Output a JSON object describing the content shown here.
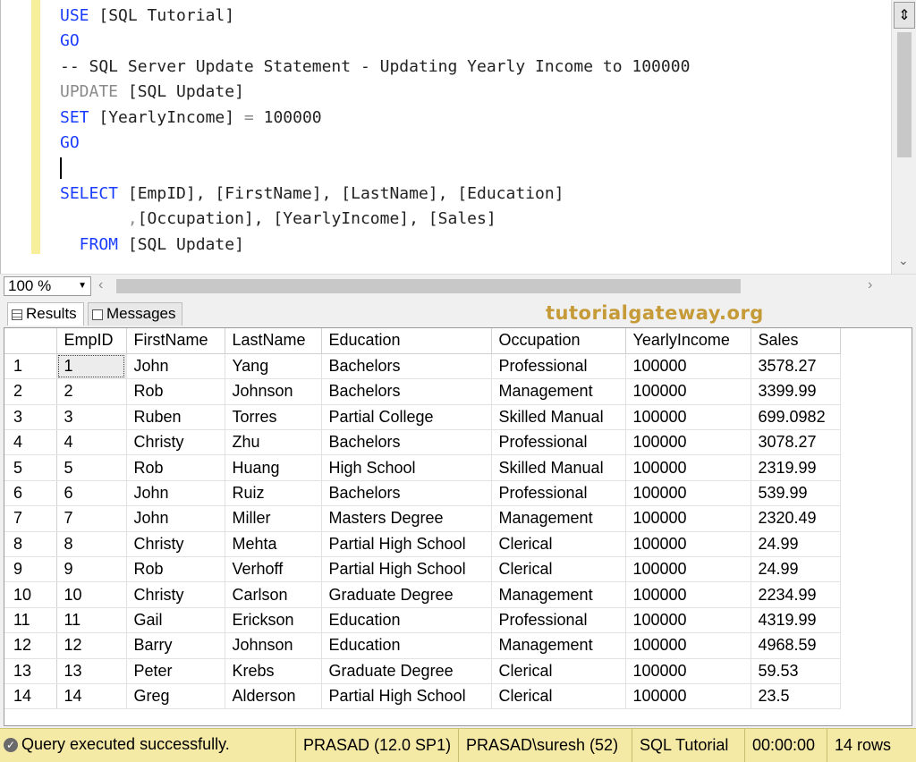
{
  "editor": {
    "lines": [
      {
        "parts": [
          {
            "t": "USE ",
            "c": "kw"
          },
          {
            "t": "[SQL Tutorial]",
            "c": "str"
          }
        ]
      },
      {
        "parts": [
          {
            "t": "GO",
            "c": "kw"
          }
        ]
      },
      {
        "parts": [
          {
            "t": "-- SQL Server Update Statement - Updating Yearly Income to 100000",
            "c": "str"
          }
        ]
      },
      {
        "parts": [
          {
            "t": "UPDATE ",
            "c": "gray"
          },
          {
            "t": "[SQL Update]",
            "c": "str"
          }
        ]
      },
      {
        "parts": [
          {
            "t": "SET ",
            "c": "kw"
          },
          {
            "t": "[YearlyIncome] ",
            "c": "str"
          },
          {
            "t": "= ",
            "c": "gray"
          },
          {
            "t": "100000",
            "c": "str"
          }
        ]
      },
      {
        "parts": [
          {
            "t": "GO",
            "c": "kw"
          }
        ]
      },
      {
        "parts": [],
        "caret": true
      },
      {
        "parts": [
          {
            "t": "SELECT ",
            "c": "kw"
          },
          {
            "t": "[EmpID], [FirstName], [LastName], [Education]",
            "c": "str"
          }
        ]
      },
      {
        "parts": [
          {
            "t": "       ,",
            "c": "gray"
          },
          {
            "t": "[Occupation], [YearlyIncome], [Sales]",
            "c": "str"
          }
        ]
      },
      {
        "parts": [
          {
            "t": "  FROM ",
            "c": "kw"
          },
          {
            "t": "[SQL Update]",
            "c": "str"
          }
        ]
      }
    ]
  },
  "zoom": {
    "value": "100 %"
  },
  "tabs": {
    "results": "Results",
    "messages": "Messages"
  },
  "brand": "tutorialgateway.org",
  "grid": {
    "columns": [
      "EmpID",
      "FirstName",
      "LastName",
      "Education",
      "Occupation",
      "YearlyIncome",
      "Sales"
    ],
    "rows": [
      [
        "1",
        "1",
        "John",
        "Yang",
        "Bachelors",
        "Professional",
        "100000",
        "3578.27"
      ],
      [
        "2",
        "2",
        "Rob",
        "Johnson",
        "Bachelors",
        "Management",
        "100000",
        "3399.99"
      ],
      [
        "3",
        "3",
        "Ruben",
        "Torres",
        "Partial College",
        "Skilled Manual",
        "100000",
        "699.0982"
      ],
      [
        "4",
        "4",
        "Christy",
        "Zhu",
        "Bachelors",
        "Professional",
        "100000",
        "3078.27"
      ],
      [
        "5",
        "5",
        "Rob",
        "Huang",
        "High School",
        "Skilled Manual",
        "100000",
        "2319.99"
      ],
      [
        "6",
        "6",
        "John",
        "Ruiz",
        "Bachelors",
        "Professional",
        "100000",
        "539.99"
      ],
      [
        "7",
        "7",
        "John",
        "Miller",
        "Masters Degree",
        "Management",
        "100000",
        "2320.49"
      ],
      [
        "8",
        "8",
        "Christy",
        "Mehta",
        "Partial High School",
        "Clerical",
        "100000",
        "24.99"
      ],
      [
        "9",
        "9",
        "Rob",
        "Verhoff",
        "Partial High School",
        "Clerical",
        "100000",
        "24.99"
      ],
      [
        "10",
        "10",
        "Christy",
        "Carlson",
        "Graduate Degree",
        "Management",
        "100000",
        "2234.99"
      ],
      [
        "11",
        "11",
        "Gail",
        "Erickson",
        "Education",
        "Professional",
        "100000",
        "4319.99"
      ],
      [
        "12",
        "12",
        "Barry",
        "Johnson",
        "Education",
        "Management",
        "100000",
        "4968.59"
      ],
      [
        "13",
        "13",
        "Peter",
        "Krebs",
        "Graduate Degree",
        "Clerical",
        "100000",
        "59.53"
      ],
      [
        "14",
        "14",
        "Greg",
        "Alderson",
        "Partial High School",
        "Clerical",
        "100000",
        "23.5"
      ]
    ]
  },
  "status": {
    "message": "Query executed successfully.",
    "server": "PRASAD (12.0 SP1)",
    "user": "PRASAD\\suresh (52)",
    "database": "SQL Tutorial",
    "elapsed": "00:00:00",
    "rows": "14 rows"
  },
  "colors": {
    "keyword": "#1a3cff",
    "status_bg": "#f5e9a6",
    "brand": "#c59a37"
  }
}
